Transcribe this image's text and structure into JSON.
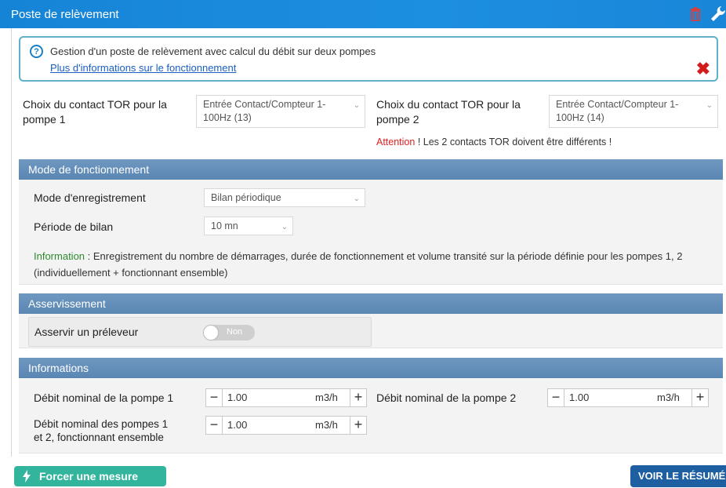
{
  "header": {
    "title": "Poste de relèvement",
    "trash_icon": "trash-icon",
    "wrench_icon": "wrench-icon"
  },
  "info": {
    "question_icon": "?",
    "description": "Gestion d'un poste de relèvement avec calcul du débit sur deux pompes",
    "link": "Plus d'informations sur le fonctionnement",
    "close": "✖"
  },
  "contacts": {
    "pump1_label_line1": "Choix du contact TOR pour la",
    "pump1_label_line2": "pompe 1",
    "pump1_value_line1": "Entrée Contact/Compteur 1-",
    "pump1_value_line2": "100Hz (13)",
    "pump2_label_line1": "Choix du contact TOR pour la",
    "pump2_label_line2": "pompe 2",
    "pump2_value_line1": "Entrée Contact/Compteur 1-",
    "pump2_value_line2": "100Hz (14)",
    "warning_prefix": "Attention",
    "warning_text": " ! Les 2 contacts TOR doivent être différents !"
  },
  "mode": {
    "title": "Mode de fonctionnement",
    "record_label": "Mode d'enregistrement",
    "record_value": "Bilan périodique",
    "period_label": "Période de bilan",
    "period_value": "10 mn",
    "info_prefix": "Information",
    "info_text": " : Enregistrement du nombre de démarrages, durée de fonctionnement et volume transité sur la période définie pour les pompes 1, 2 (individuellement + fonctionnant ensemble)"
  },
  "servo": {
    "title": "Asservissement",
    "label": "Asservir un préleveur",
    "toggle_text": "Non"
  },
  "informations": {
    "title": "Informations",
    "pump1_label": "Débit nominal de la pompe 1",
    "pump1_value": "1.00",
    "pump2_label": "Débit nominal de la pompe 2",
    "pump2_value": "1.00",
    "both_label_line1": "Débit nominal des pompes 1",
    "both_label_line2": "et 2, fonctionnant ensemble",
    "both_value": "1.00",
    "unit": "m3/h",
    "minus": "−",
    "plus": "+"
  },
  "actions": {
    "force_label": "Forcer une mesure",
    "resume_label": "VOIR LE RÉSUMÉ"
  },
  "colors": {
    "title_bar": "#1d8fe0",
    "section_header": "#5f8bb7",
    "warning": "#e02020",
    "info_green": "#2e8b2e",
    "force_button": "#33b59d",
    "resume_button": "#1d5fa0",
    "close_x": "#d21b1b"
  }
}
